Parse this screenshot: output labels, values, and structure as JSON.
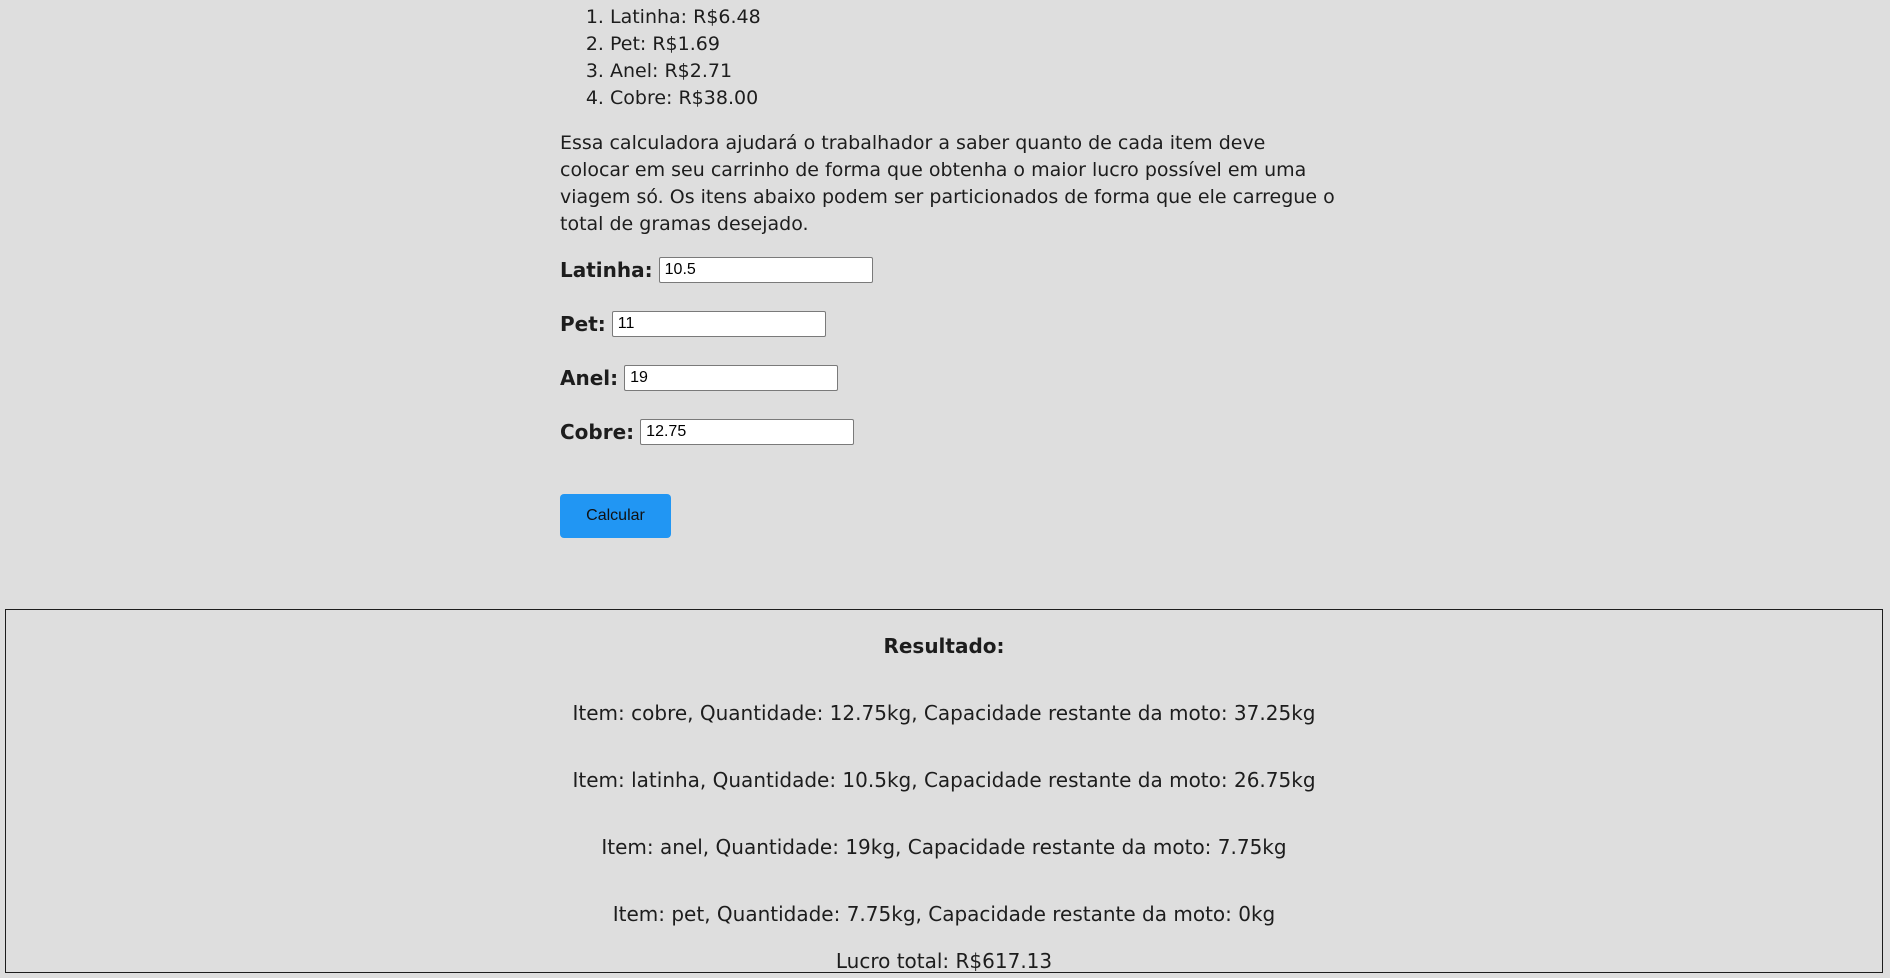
{
  "prices": [
    {
      "label": "Latinha: R$6.48"
    },
    {
      "label": "Pet: R$1.69"
    },
    {
      "label": "Anel: R$2.71"
    },
    {
      "label": "Cobre: R$38.00"
    }
  ],
  "intro_text": "Essa calculadora ajudará o trabalhador a saber quanto de cada item deve colocar em seu carrinho de forma que obtenha o maior lucro possível em uma viagem só. Os itens abaixo podem ser particionados de forma que ele carregue o total de gramas desejado.",
  "fields": {
    "latinha": {
      "label": "Latinha:",
      "value": "10.5"
    },
    "pet": {
      "label": "Pet:",
      "value": "11"
    },
    "anel": {
      "label": "Anel:",
      "value": "19"
    },
    "cobre": {
      "label": "Cobre:",
      "value": "12.75"
    }
  },
  "calculate_button": "Calcular",
  "result": {
    "title": "Resultado:",
    "lines": [
      "Item: cobre, Quantidade: 12.75kg, Capacidade restante da moto: 37.25kg",
      "Item: latinha, Quantidade: 10.5kg, Capacidade restante da moto: 26.75kg",
      "Item: anel, Quantidade: 19kg, Capacidade restante da moto: 7.75kg",
      "Item: pet, Quantidade: 7.75kg, Capacidade restante da moto: 0kg"
    ],
    "total": "Lucro total: R$617.13"
  },
  "colors": {
    "background": "#dedede",
    "button": "#2196f3"
  }
}
